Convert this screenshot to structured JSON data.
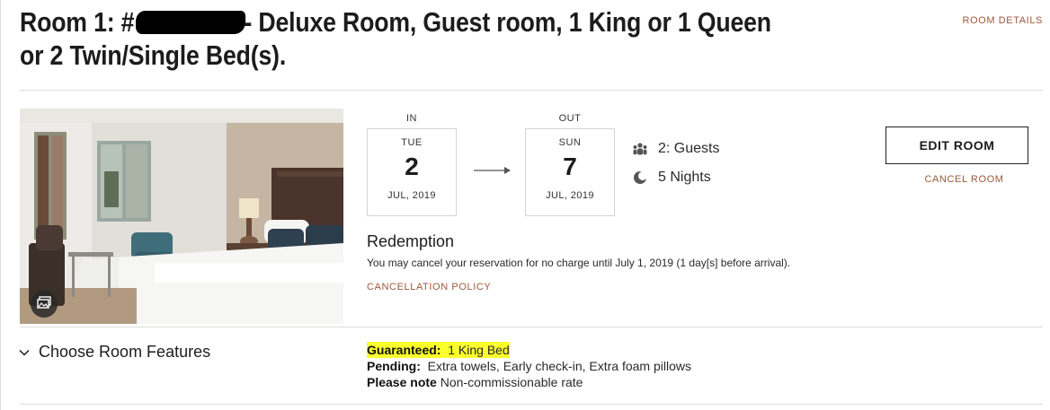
{
  "header": {
    "title_prefix": "Room  1:  #",
    "title_suffix": "- Deluxe Room, Guest room, 1 King or 1 Queen or 2 Twin/Single Bed(s).",
    "room_details_link": "ROOM DETAILS"
  },
  "stay": {
    "check_in": {
      "label": "IN",
      "dow": "TUE",
      "day": "2",
      "month_year": "JUL, 2019"
    },
    "check_out": {
      "label": "OUT",
      "dow": "SUN",
      "day": "7",
      "month_year": "JUL, 2019"
    },
    "guests": "2: Guests",
    "nights": "5 Nights"
  },
  "actions": {
    "edit_room": "EDIT ROOM",
    "cancel_room": "CANCEL ROOM"
  },
  "rate": {
    "title": "Redemption",
    "description": "You may cancel your reservation for no charge until July 1, 2019 (1 day[s] before arrival).",
    "cancellation_policy_link": "CANCELLATION POLICY"
  },
  "features": {
    "toggle_label": "Choose Room Features",
    "guaranteed_label": "Guaranteed:",
    "guaranteed_value": "1 King Bed",
    "pending_label": "Pending:",
    "pending_value": "Extra towels,  Early check-in,  Extra foam pillows",
    "note_label": "Please note",
    "note_value": "Non-commissionable rate"
  },
  "colors": {
    "link_accent": "#9a5a3c",
    "highlight": "#fbff2c"
  },
  "icons": {
    "guests": "people-group-icon",
    "nights": "moon-icon",
    "gallery": "image-gallery-icon",
    "features_toggle": "chevron-down-icon",
    "dates": "arrow-right-icon"
  }
}
